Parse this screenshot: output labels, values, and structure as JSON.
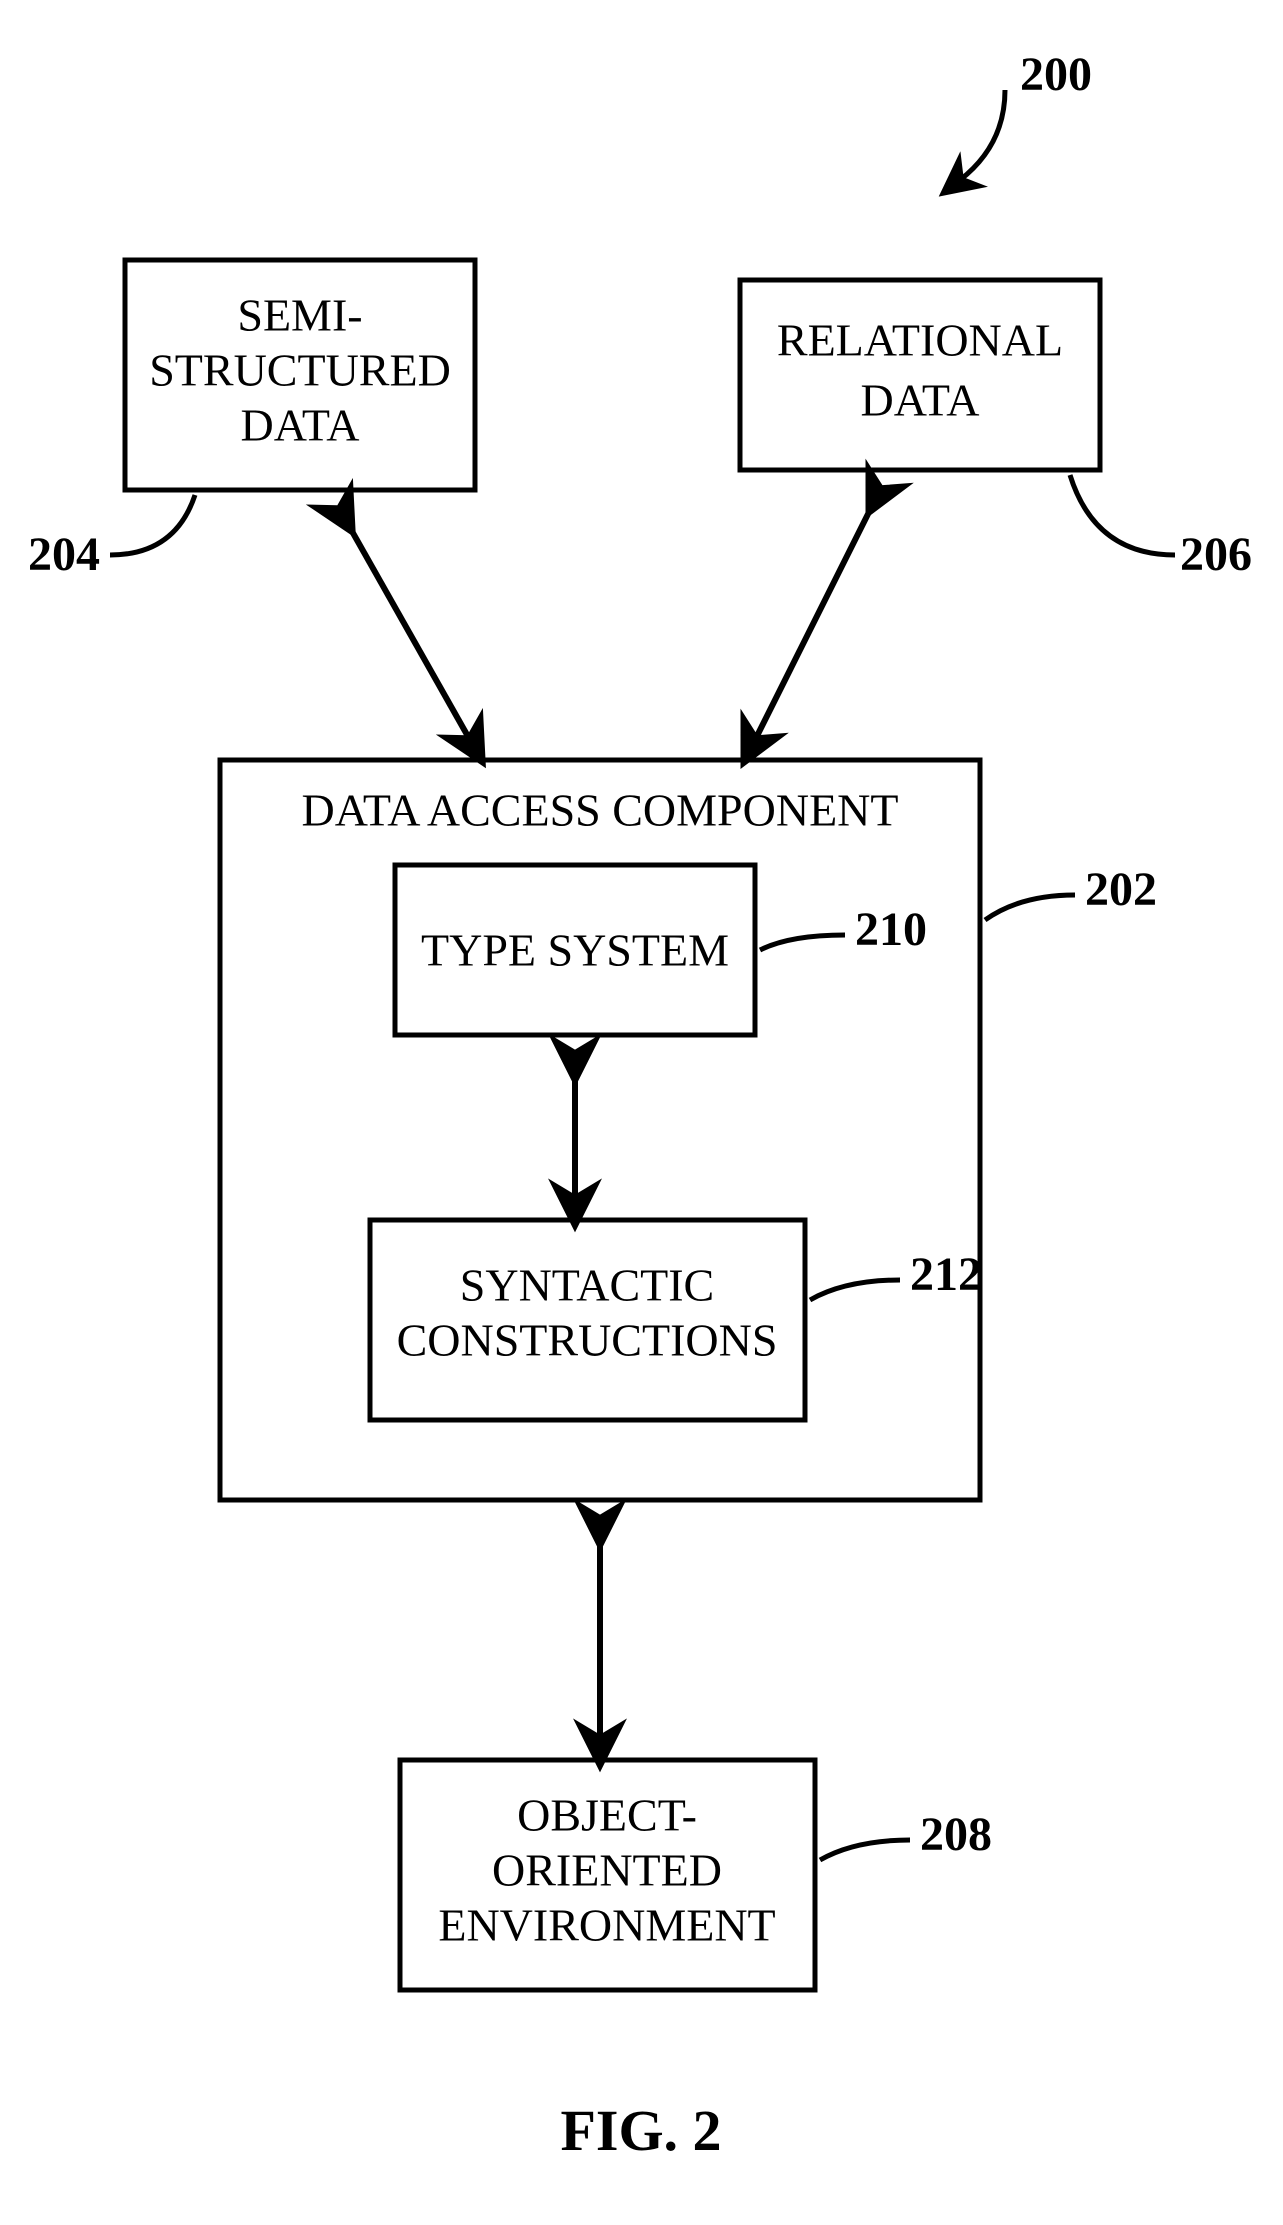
{
  "figure": {
    "ref_overall": "200",
    "caption": "FIG. 2",
    "boxes": {
      "semi": {
        "line1": "SEMI-",
        "line2": "STRUCTURED",
        "line3": "DATA",
        "ref": "204"
      },
      "relational": {
        "line1": "RELATIONAL",
        "line2": "DATA",
        "ref": "206"
      },
      "access": {
        "title": "DATA ACCESS COMPONENT",
        "ref": "202"
      },
      "type": {
        "line1": "TYPE SYSTEM",
        "ref": "210"
      },
      "syntax": {
        "line1": "SYNTACTIC",
        "line2": "CONSTRUCTIONS",
        "ref": "212"
      },
      "env": {
        "line1": "OBJECT-",
        "line2": "ORIENTED",
        "line3": "ENVIRONMENT",
        "ref": "208"
      }
    }
  }
}
